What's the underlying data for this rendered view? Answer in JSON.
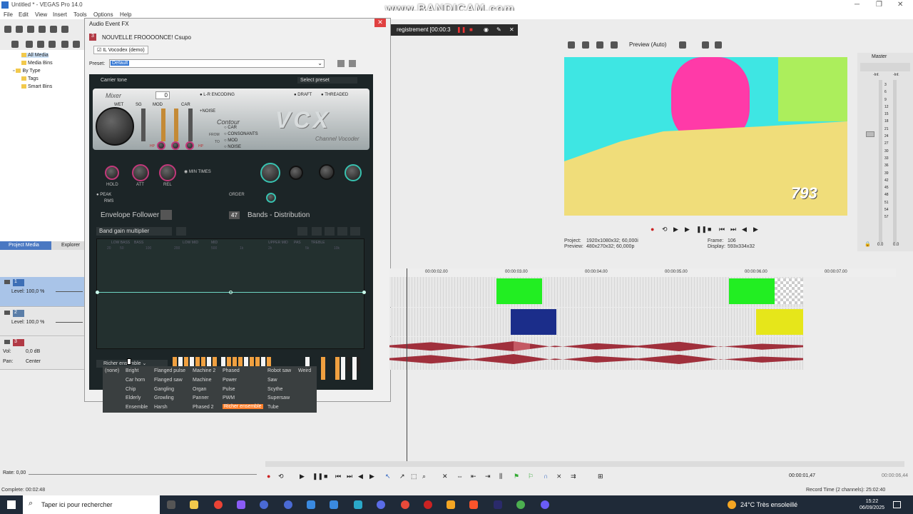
{
  "window": {
    "title": "Untitled * - VEGAS Pro 14.0"
  },
  "watermark": "www.BANDICAM.com",
  "menu": [
    "File",
    "Edit",
    "View",
    "Insert",
    "Tools",
    "Options",
    "Help"
  ],
  "project_media": {
    "tree": [
      "All Media",
      "Media Bins",
      "By Type",
      "Tags",
      "Smart Bins"
    ],
    "tabs": [
      "Project Media",
      "Explorer"
    ]
  },
  "tracks": [
    {
      "num": "1",
      "level": "Level: 100,0 %"
    },
    {
      "num": "2",
      "level": "Level: 100,0 %"
    },
    {
      "num": "3",
      "vol_label": "Vol:",
      "vol_value": "0,0 dB",
      "pan_label": "Pan:",
      "pan_value": "Center"
    }
  ],
  "fx_window": {
    "title": "Audio Event FX",
    "event_name": "NOUVELLE FROOOONCE! Csupo",
    "chain_item": "IL Vocodex (demo)",
    "preset_label": "Preset:",
    "preset_value": "Default",
    "carrier": "Carrier tone",
    "select_preset": "Select preset",
    "mixer": "Mixer",
    "mixer_value": "0",
    "lr_encoding": "L-R ENCODING",
    "draft": "DRAFT",
    "threaded": "THREADED",
    "wet": "WET",
    "sg": "SG",
    "mod": "MOD",
    "car": "CAR",
    "noise": "+NOISE",
    "contour": "Contour",
    "contour_opts": [
      "CAR",
      "CONSONANTS",
      "MOD",
      "NOISE"
    ],
    "from": "FROM",
    "to": "TO",
    "hp1": "HP",
    "hp2": "HP",
    "logo": "VCX",
    "logo_sub": "Channel Vocoder",
    "hold": "HOLD",
    "att": "ATT",
    "rel": "REL",
    "min_times": "MIN TIMES",
    "order": "ORDER",
    "peak": "PEAK",
    "rms": "RMS",
    "envelope_follower": "Envelope Follower",
    "bands_count": "47",
    "bands": "Bands - Distribution",
    "band_gain": "Band gain multiplier",
    "freq_ranges": [
      "LOW BASS",
      "BASS",
      "LOW MID",
      "MID",
      "UPPER MID",
      "PAS",
      "TREBLE"
    ],
    "freq_ticks": [
      "20",
      "50",
      "100",
      "200",
      "500",
      "1k",
      "2k",
      "5k",
      "10k"
    ],
    "carrier_preset": "Richer ensemble"
  },
  "preset_menu": {
    "columns": [
      [
        "(none)"
      ],
      [
        "Bright",
        "Car horn",
        "Chip",
        "Elderly",
        "Ensemble"
      ],
      [
        "Flanged pulse",
        "Flanged saw",
        "Gangling",
        "Growling",
        "Harsh"
      ],
      [
        "Machine 2",
        "Machine",
        "Organ",
        "Panner",
        "Phased 2"
      ],
      [
        "Phased",
        "Power",
        "Pulse",
        "PWM",
        "Richer ensemble"
      ],
      [
        "Robot saw",
        "Saw",
        "Scythe",
        "Supersaw",
        "Tube"
      ],
      [
        "Weird"
      ]
    ],
    "selected": "Richer ensemble"
  },
  "recorder": {
    "text": "registrement [00:00:3"
  },
  "preview": {
    "mode": "Preview (Auto)",
    "overlay_text": "793",
    "project_label": "Project:",
    "project_value": "1920x1080x32; 60,000i",
    "preview_label": "Preview:",
    "preview_value": "480x270x32; 60,000p",
    "frame_label": "Frame:",
    "frame_value": "106",
    "display_label": "Display:",
    "display_value": "593x334x32"
  },
  "master": {
    "title": "Master",
    "scale": [
      "3",
      "6",
      "9",
      "12",
      "15",
      "18",
      "21",
      "24",
      "27",
      "30",
      "33",
      "36",
      "39",
      "42",
      "45",
      "48",
      "51",
      "54",
      "57"
    ],
    "inf1": "-Inf.",
    "inf2": "-Inf.",
    "out1": "0.0",
    "out2": "0.0"
  },
  "ruler": [
    "00:00:02.00",
    "00:00:03.00",
    "00:00:04.00",
    "00:00:05.00",
    "00:00:06.00",
    "00:00:07.00"
  ],
  "transport": {
    "position": "00:00:01,47",
    "end": "00:00:06,44"
  },
  "rate": "Rate: 0,00",
  "status": {
    "complete": "Complete: 00:02:48",
    "record_time": "Record Time (2 channels): 25:02:40"
  },
  "taskbar": {
    "search_placeholder": "Taper ici pour rechercher",
    "weather": "24°C  Très ensoleillé",
    "time": "15:22",
    "date": "06/09/2025"
  },
  "colors": {
    "accent": "#ff7f2a",
    "teal": "#38c2b0",
    "clip_green": "#22ee22",
    "clip_yellow": "#e6e61a",
    "waveform": "#a0303c"
  }
}
